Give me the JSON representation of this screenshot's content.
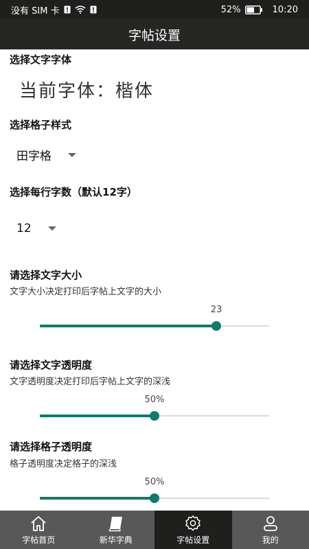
{
  "status": {
    "carrier": "没有 SIM 卡",
    "battery": "52%",
    "time": "10:20"
  },
  "appbar": {
    "title": "字帖设置"
  },
  "font_section": {
    "title": "选择文字字体",
    "current": "当前字体：楷体"
  },
  "grid_style": {
    "title": "选择格子样式",
    "selected": "田字格"
  },
  "per_line": {
    "title": "选择每行字数（默认12字）",
    "selected": "12"
  },
  "text_size": {
    "title": "请选择文字大小",
    "desc": "文字大小决定打印后字帖上文字的大小",
    "value_label": "23",
    "fraction": 0.77
  },
  "text_opacity": {
    "title": "请选择文字透明度",
    "desc": "文字透明度决定打印后字帖上文字的深浅",
    "value_label": "50%",
    "fraction": 0.5
  },
  "grid_opacity": {
    "title": "请选择格子透明度",
    "desc": "格子透明度决定格子的深浅",
    "value_label": "50%",
    "fraction": 0.5
  },
  "tabs": [
    {
      "label": "字帖首页",
      "icon": "home-icon"
    },
    {
      "label": "新华字典",
      "icon": "book-icon"
    },
    {
      "label": "字帖设置",
      "icon": "gear-icon"
    },
    {
      "label": "我的",
      "icon": "user-icon"
    }
  ],
  "colors": {
    "accent": "#0f7b6c",
    "appbar": "#262624",
    "tabbar": "#585858"
  }
}
